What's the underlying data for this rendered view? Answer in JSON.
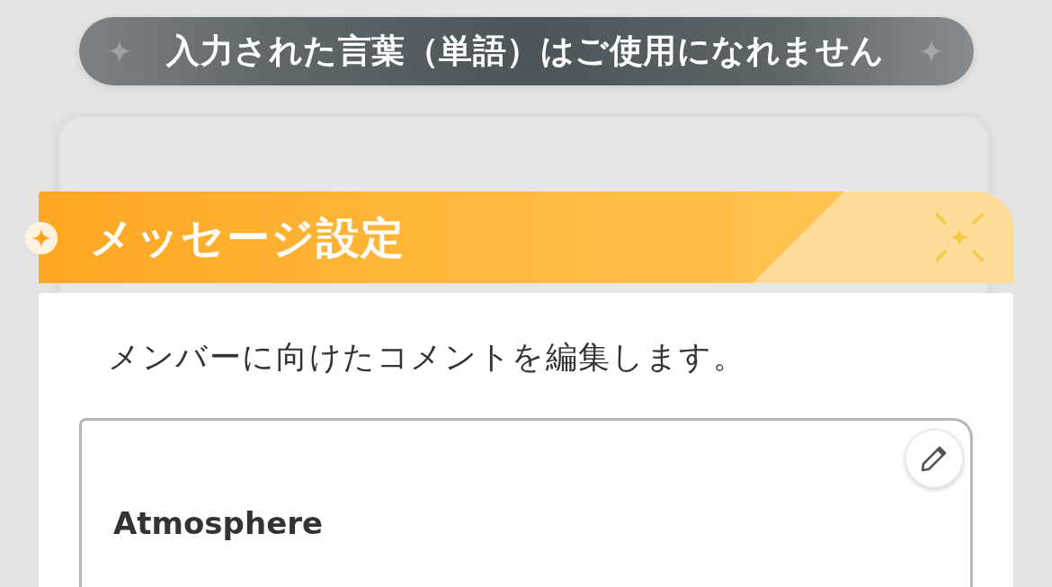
{
  "toast": {
    "message": "入力された言葉（単語）はご使用になれません"
  },
  "dialog": {
    "title": "メッセージ設定",
    "description": "メンバーに向けたコメントを編集します。",
    "comment_field": {
      "value": "Atmosphere"
    }
  }
}
